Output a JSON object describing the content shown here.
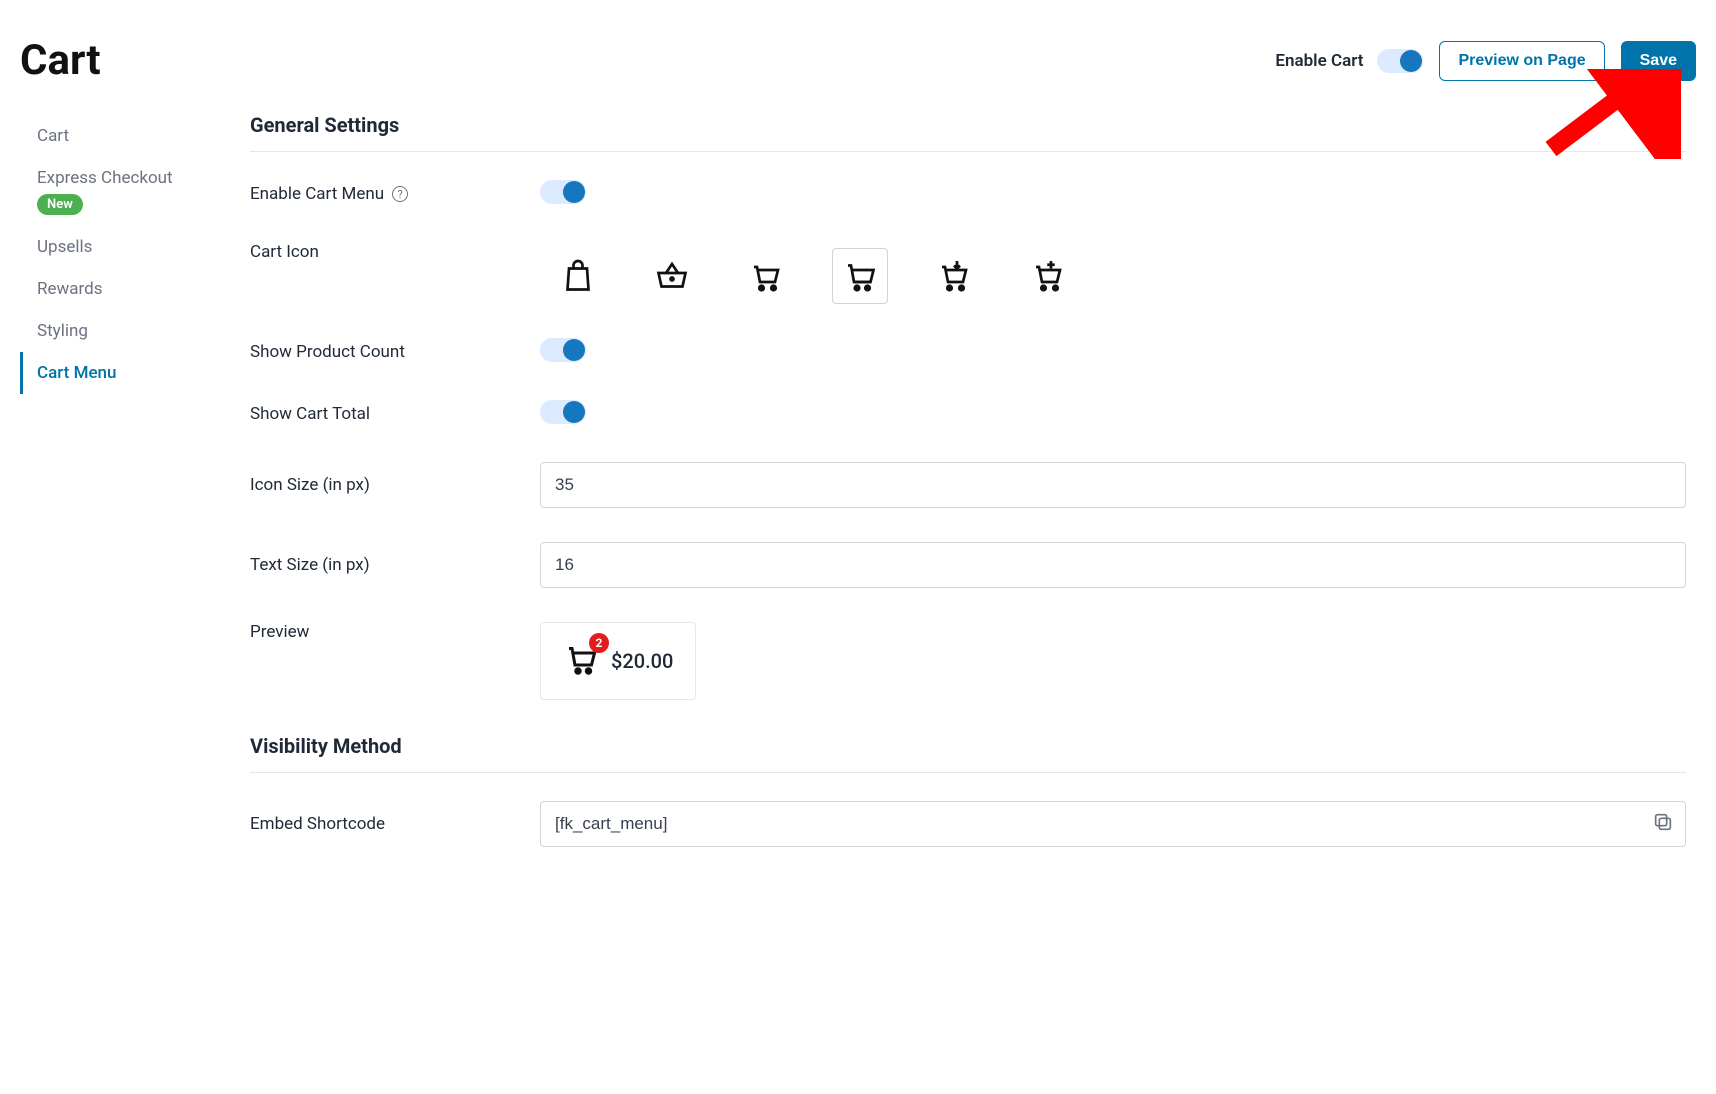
{
  "header": {
    "title": "Cart",
    "enable_cart_label": "Enable Cart",
    "preview_button": "Preview on Page",
    "save_button": "Save"
  },
  "sidebar": {
    "items": [
      {
        "label": "Cart"
      },
      {
        "label": "Express Checkout",
        "badge": "New"
      },
      {
        "label": "Upsells"
      },
      {
        "label": "Rewards"
      },
      {
        "label": "Styling"
      },
      {
        "label": "Cart Menu"
      }
    ]
  },
  "sections": {
    "general": {
      "title": "General Settings",
      "enable_menu_label": "Enable Cart Menu",
      "cart_icon_label": "Cart Icon",
      "show_count_label": "Show Product Count",
      "show_total_label": "Show Cart Total",
      "icon_size_label": "Icon Size (in px)",
      "icon_size_value": "35",
      "text_size_label": "Text Size (in px)",
      "text_size_value": "16",
      "preview_label": "Preview",
      "preview_count": "2",
      "preview_total": "$20.00"
    },
    "visibility": {
      "title": "Visibility Method",
      "shortcode_label": "Embed Shortcode",
      "shortcode_value": "[fk_cart_menu]"
    }
  },
  "icon_names": [
    "shopping-bag-icon",
    "basket-icon",
    "cart-icon",
    "cart-alt-icon",
    "cart-down-icon",
    "cart-plus-icon"
  ]
}
